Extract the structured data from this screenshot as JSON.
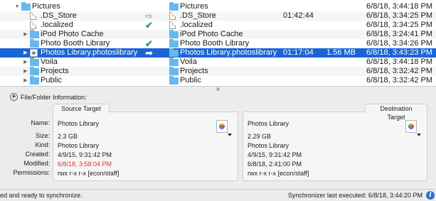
{
  "colors": {
    "selection": "#1a65d6",
    "folder": "#69b8ec",
    "check": "#2da04a",
    "modified_red": "#e0352b",
    "info_blue": "#2f6fd8"
  },
  "rows": [
    {
      "disclosure": "▼",
      "name": "Pictures",
      "icon": "folder-icon",
      "action": "",
      "dest_name": "Pictures",
      "dest_icon": "folder-icon",
      "duration": "",
      "size": "",
      "date": "6/8/18, 3:44:18 PM"
    },
    {
      "disclosure": "",
      "name": ".DS_Store",
      "icon": "document-icon",
      "action": "⇨",
      "action_icon": "arrow-right-icon",
      "dest_name": ".DS_Store",
      "dest_icon": "document-icon",
      "duration": "01:42:44",
      "size": "",
      "date": "6/8/18, 3:34:25 PM"
    },
    {
      "disclosure": "",
      "name": ".localized",
      "icon": "document-icon",
      "action": "✔",
      "action_icon": "checkmark-icon",
      "dest_name": ".localized",
      "dest_icon": "document-icon",
      "duration": "",
      "size": "",
      "date": "6/8/18, 3:34:25 PM"
    },
    {
      "disclosure": "▶",
      "name": "iPod Photo Cache",
      "icon": "folder-icon",
      "action": "",
      "dest_name": "iPod Photo Cache",
      "dest_icon": "folder-icon",
      "duration": "",
      "size": "",
      "date": "6/8/18, 3:24:41 PM"
    },
    {
      "disclosure": "",
      "name": "Photo Booth Library",
      "icon": "folder-icon",
      "action": "✔",
      "action_icon": "checkmark-icon",
      "dest_name": "Photo Booth Library",
      "dest_icon": "folder-icon",
      "duration": "",
      "size": "",
      "date": "6/8/18, 3:34:26 PM"
    },
    {
      "disclosure": "▶",
      "name": "Photos Library.photoslibrary",
      "icon": "photos-library-icon",
      "action": "➡",
      "action_icon": "arrow-right-icon",
      "dest_name": "Photos Library.photoslibrary",
      "dest_icon": "folder-icon",
      "duration": "01:17:04",
      "size": "1.56 MB",
      "date": "6/8/18, 3:43:23 PM",
      "selected": true
    },
    {
      "disclosure": "▶",
      "name": "Voila",
      "icon": "folder-icon",
      "action": "",
      "dest_name": "Voila",
      "dest_icon": "folder-icon",
      "duration": "",
      "size": "",
      "date": "6/8/18, 3:44:18 PM"
    },
    {
      "disclosure": "▶",
      "name": "Projects",
      "icon": "folder-icon",
      "action": "",
      "dest_name": "Projects",
      "dest_icon": "folder-icon",
      "duration": "",
      "size": "",
      "date": "6/8/18, 3:32:42 PM"
    },
    {
      "disclosure": "▶",
      "name": "Public",
      "icon": "folder-icon",
      "action": "",
      "dest_name": "Public",
      "dest_icon": "folder-icon",
      "duration": "",
      "size": "",
      "date": "6/8/18, 3:32:42 PM"
    }
  ],
  "info": {
    "title": "File/Folder Information:",
    "labels": {
      "name": "Name:",
      "size": "Size:",
      "kind": "Kind:",
      "created": "Created:",
      "modified": "Modified:",
      "permissions": "Permissions:"
    },
    "source": {
      "tab": "Source Target",
      "name": "Photos Library",
      "size": "2.3 GB",
      "kind": "Photos Library",
      "created": "4/9/15, 9:31:42 PM",
      "modified": "6/8/18, 3:58:04 PM",
      "permissions": "rwx r-x r-x   [econ/staff]"
    },
    "destination": {
      "tab": "Destination Target",
      "name": "Photos Library",
      "size": "2.29 GB",
      "kind": "Photos Library",
      "created": "4/9/15, 9:31:42 PM",
      "modified": "6/8/18, 2:41:00 PM",
      "permissions": "rwx r-x r-x   [econ/staff]"
    }
  },
  "status": {
    "left": "ed and ready to synchronize.",
    "right": "Synchronizer last executed:  6/8/18, 3:44:20 PM"
  }
}
